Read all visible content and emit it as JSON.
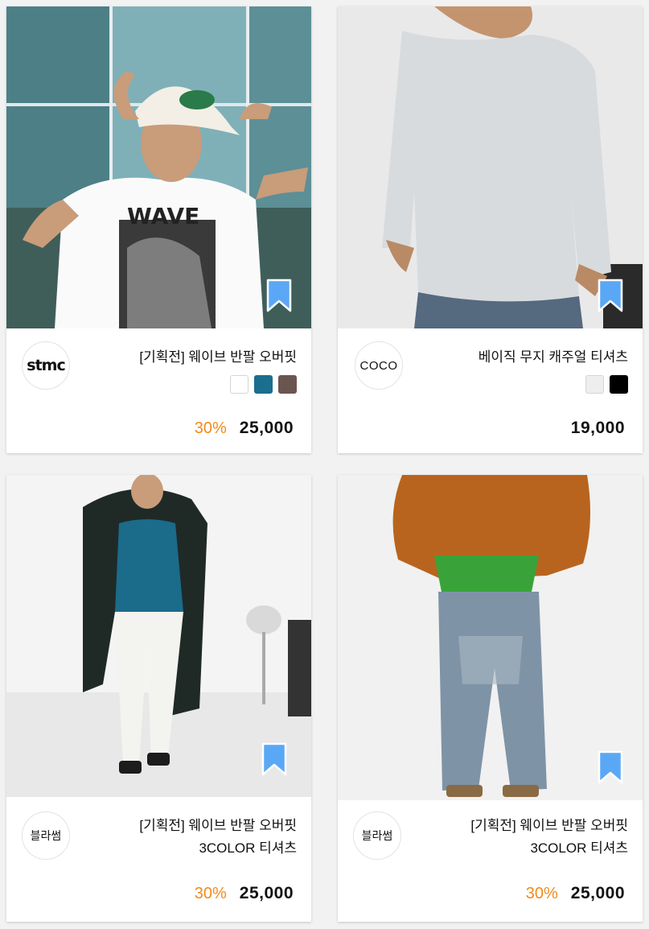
{
  "accent_color": "#f28a1b",
  "bookmark_color": "#5aa8f5",
  "products": [
    {
      "brand": "stmc",
      "title_line1": "[기획전] 웨이브 반팔 오버핏",
      "title_line2": "",
      "colors": [
        "#ffffff",
        "#1a6e8e",
        "#6b5550"
      ],
      "discount": "30%",
      "price": "25,000"
    },
    {
      "brand": "COCO",
      "title_line1": "베이직 무지 캐주얼 티셔츠",
      "title_line2": "",
      "colors": [
        "#eeeeee",
        "#000000"
      ],
      "discount": "",
      "price": "19,000"
    },
    {
      "brand": "블라썸",
      "title_line1": "[기획전] 웨이브 반팔 오버핏",
      "title_line2": "3COLOR 티셔츠",
      "colors": [],
      "discount": "30%",
      "price": "25,000"
    },
    {
      "brand": "블라썸",
      "title_line1": "[기획전] 웨이브 반팔 오버핏",
      "title_line2": "3COLOR 티셔츠",
      "colors": [],
      "discount": "30%",
      "price": "25,000"
    }
  ]
}
